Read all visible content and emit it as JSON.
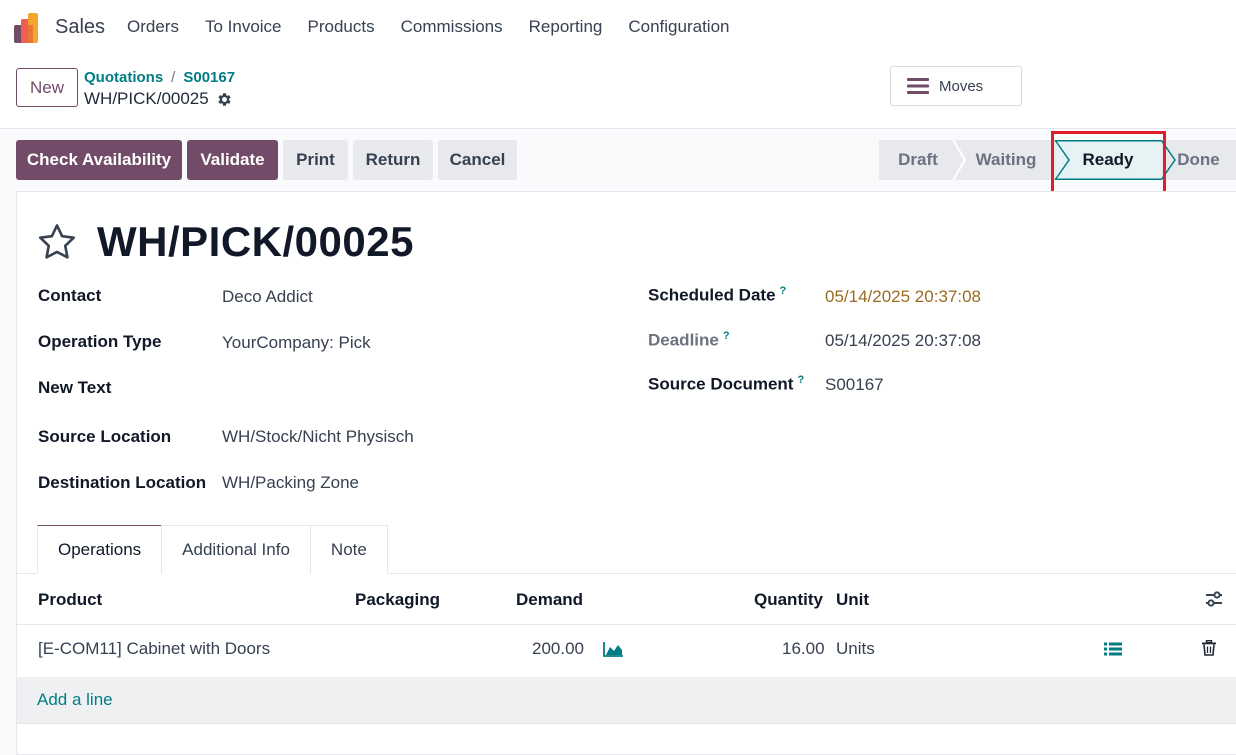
{
  "nav": {
    "app_name": "Sales",
    "menu": [
      "Orders",
      "To Invoice",
      "Products",
      "Commissions",
      "Reporting",
      "Configuration"
    ]
  },
  "control_panel": {
    "new_label": "New",
    "breadcrumb": [
      "Quotations",
      "S00167"
    ],
    "record_name": "WH/PICK/00025",
    "moves_label": "Moves"
  },
  "actions": {
    "check_availability": "Check Availability",
    "validate": "Validate",
    "print": "Print",
    "return": "Return",
    "cancel": "Cancel"
  },
  "status": {
    "stages": [
      "Draft",
      "Waiting",
      "Ready",
      "Done"
    ],
    "current": "Ready"
  },
  "form": {
    "title": "WH/PICK/00025",
    "left_fields": [
      {
        "label": "Contact",
        "value": "Deco Addict"
      },
      {
        "label": "Operation Type",
        "value": "YourCompany: Pick"
      },
      {
        "label": "New Text",
        "value": ""
      },
      {
        "label": "Source Location",
        "value": "WH/Stock/Nicht Physisch"
      },
      {
        "label": "Destination Location",
        "value": "WH/Packing Zone"
      }
    ],
    "right_fields": [
      {
        "label": "Scheduled Date",
        "help": "?",
        "value": "05/14/2025 20:37:08"
      },
      {
        "label": "Deadline",
        "help": "?",
        "value": "05/14/2025 20:37:08"
      },
      {
        "label": "Source Document",
        "help": "?",
        "value": "S00167"
      }
    ]
  },
  "tabs": [
    "Operations",
    "Additional Info",
    "Note"
  ],
  "table": {
    "headers": {
      "product": "Product",
      "packaging": "Packaging",
      "demand": "Demand",
      "quantity": "Quantity",
      "unit": "Unit"
    },
    "rows": [
      {
        "product": "[E-COM11] Cabinet with Doors",
        "packaging": "",
        "demand": "200.00",
        "quantity": "16.00",
        "unit": "Units"
      }
    ],
    "add_line": "Add a line"
  },
  "icons": {
    "star": "star-icon",
    "gear": "gear-icon",
    "hamburger": "hamburger-icon",
    "forecast": "area-chart-icon",
    "details": "list-icon",
    "delete": "trash-icon",
    "optional_columns": "sliders-icon"
  },
  "colors": {
    "primary": "#714b67",
    "link": "#017e84",
    "warning_date": "#9a6b22",
    "highlight": "#e11d2b"
  }
}
